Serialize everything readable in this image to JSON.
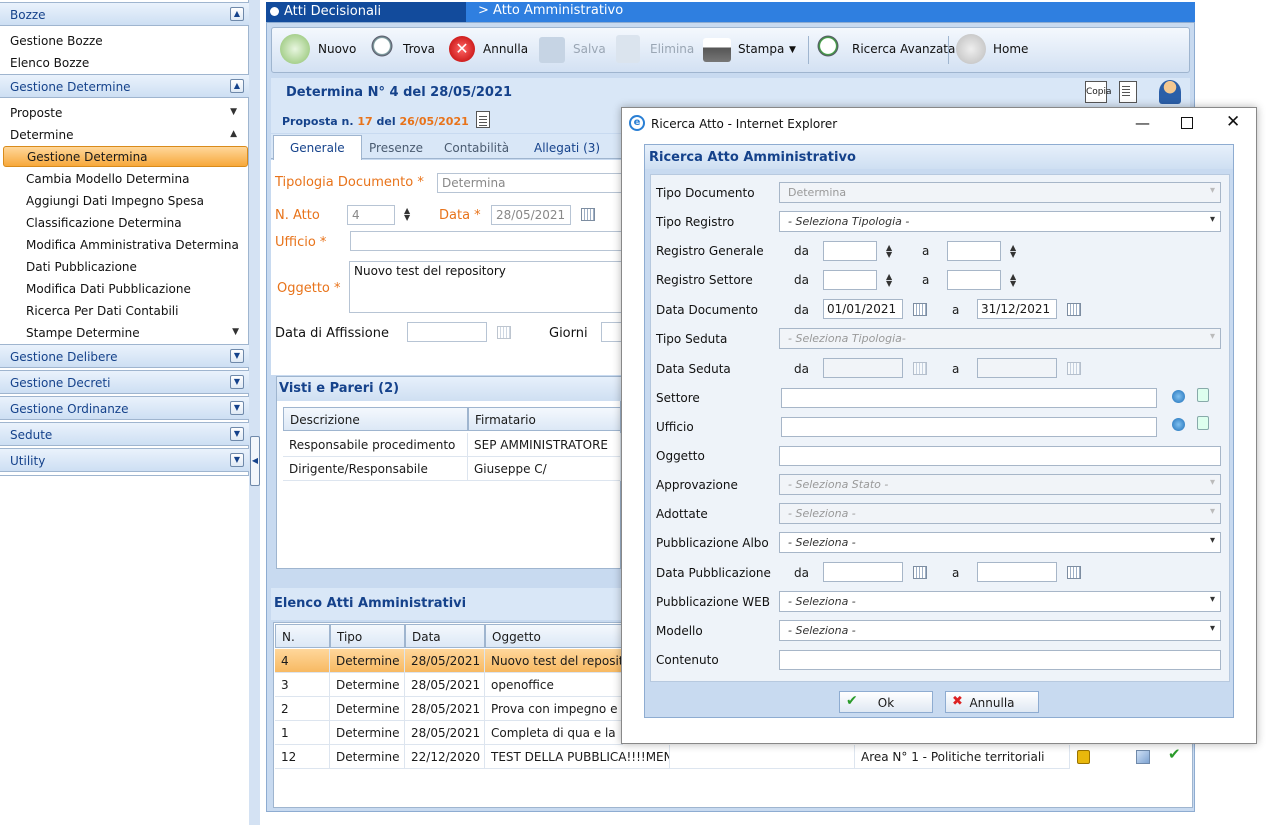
{
  "sidebar": {
    "sections": [
      {
        "label": "Bozze"
      },
      {
        "label": "Gestione Determine"
      },
      {
        "label": "Gestione Delibere"
      },
      {
        "label": "Gestione Decreti"
      },
      {
        "label": "Gestione Ordinanze"
      },
      {
        "label": "Sedute"
      },
      {
        "label": "Utility"
      }
    ],
    "bozze_items": [
      "Gestione Bozze",
      "Elenco Bozze"
    ],
    "determine_groups": [
      "Proposte",
      "Determine"
    ],
    "determine_items": [
      "Gestione Determina",
      "Cambia Modello Determina",
      "Aggiungi Dati Impegno Spesa",
      "Classificazione Determina",
      "Modifica Amministrativa Determina",
      "Dati Pubblicazione",
      "Modifica Dati Pubblicazione",
      "Ricerca Per Dati Contabili",
      "Stampe Determine"
    ]
  },
  "main": {
    "title_left": "Atti Decisionali",
    "title_right": "> Atto Amministrativo",
    "toolbar": {
      "nuovo": "Nuovo",
      "trova": "Trova",
      "annulla": "Annulla",
      "salva": "Salva",
      "elimina": "Elimina",
      "stampa": "Stampa",
      "ricerca_avanzata": "Ricerca Avanzata",
      "home": "Home"
    },
    "header": {
      "title": "Determina N° 4 del 28/05/2021",
      "proposta_prefix": "Proposta n.",
      "proposta_num": "17",
      "proposta_del": "del",
      "proposta_date": "26/05/2021",
      "copia": "Copia"
    },
    "tabs": [
      "Generale",
      "Presenze",
      "Contabilità",
      "Allegati  (3)"
    ],
    "form": {
      "tipologia_label": "Tipologia Documento *",
      "tipologia_value": "Determina",
      "natto_label": "N. Atto",
      "natto_value": "4",
      "data_label": "Data *",
      "data_value": "28/05/2021",
      "ufficio_label": "Ufficio *",
      "oggetto_label": "Oggetto *",
      "oggetto_value": "Nuovo test del repository",
      "affissione_label": "Data di Affissione",
      "giorni_label": "Giorni"
    },
    "visti": {
      "title": "Visti e Pareri (2)",
      "columns": [
        "Descrizione",
        "Firmatario"
      ],
      "rows": [
        [
          "Responsabile procedimento",
          "SEP AMMINISTRATORE"
        ],
        [
          "Dirigente/Responsabile",
          "Giuseppe C/"
        ]
      ]
    },
    "elenco": {
      "title": "Elenco Atti Amministrativi",
      "columns": [
        "N.",
        "Tipo",
        "Data",
        "Oggetto"
      ],
      "rows": [
        [
          "4",
          "Determine",
          "28/05/2021",
          "Nuovo test del repositor"
        ],
        [
          "3",
          "Determine",
          "28/05/2021",
          "openoffice"
        ],
        [
          "2",
          "Determine",
          "28/05/2021",
          "Prova con impegno e alt"
        ],
        [
          "1",
          "Determine",
          "28/05/2021",
          "Completa di qua e la"
        ],
        [
          "12",
          "Determine",
          "22/12/2020",
          "TEST DELLA PUBBLICA!!!!MEN..."
        ]
      ],
      "last_row_area": "Area N° 1 - Politiche territoriali"
    }
  },
  "dialog": {
    "window_title": "Ricerca Atto - Internet Explorer",
    "header": "Ricerca Atto Amministrativo",
    "labels": {
      "tipo_documento": "Tipo Documento",
      "tipo_registro": "Tipo Registro",
      "registro_generale": "Registro Generale",
      "registro_settore": "Registro Settore",
      "data_documento": "Data Documento",
      "tipo_seduta": "Tipo Seduta",
      "data_seduta": "Data Seduta",
      "settore": "Settore",
      "ufficio": "Ufficio",
      "oggetto": "Oggetto",
      "approvazione": "Approvazione",
      "adottate": "Adottate",
      "pubblicazione_albo": "Pubblicazione Albo",
      "data_pubblicazione": "Data Pubblicazione",
      "pubblicazione_web": "Pubblicazione WEB",
      "modello": "Modello",
      "contenuto": "Contenuto",
      "da": "da",
      "a": "a"
    },
    "values": {
      "tipo_documento": "Determina",
      "tipo_registro": "- Seleziona Tipologia -",
      "data_documento_da": "01/01/2021",
      "data_documento_a": "31/12/2021",
      "tipo_seduta": "- Seleziona Tipologia-",
      "approvazione": "- Seleziona Stato -",
      "adottate": "- Seleziona  -",
      "pubblicazione_albo": "- Seleziona  -",
      "pubblicazione_web": "- Seleziona  -",
      "modello": "- Seleziona  -"
    },
    "buttons": {
      "ok": "Ok",
      "annulla": "Annulla"
    }
  }
}
